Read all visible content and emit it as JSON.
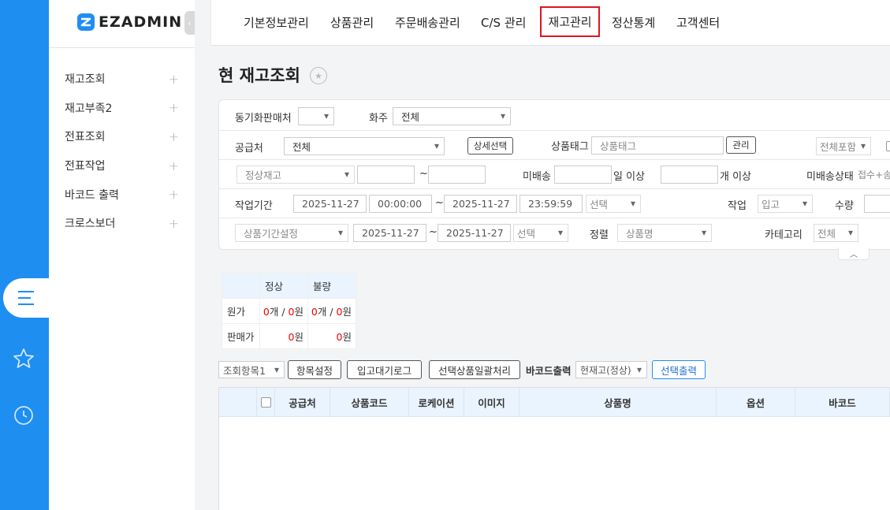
{
  "brand": {
    "logo_text": "EZADMIN",
    "accent": "#1f8ef1"
  },
  "sidebar": {
    "items": [
      {
        "label": "재고조회"
      },
      {
        "label": "재고부족2"
      },
      {
        "label": "전표조회"
      },
      {
        "label": "전표작업"
      },
      {
        "label": "바코드 출력"
      },
      {
        "label": "크로스보더"
      }
    ]
  },
  "rail": {
    "icons": [
      "menu-icon",
      "star-icon",
      "clock-icon"
    ]
  },
  "topnav": {
    "items": [
      "기본정보관리",
      "상품관리",
      "주문배송관리",
      "C/S 관리",
      "재고관리",
      "정산통계",
      "고객센터"
    ],
    "active": "재고관리"
  },
  "page": {
    "title": "현 재고조회"
  },
  "filter": {
    "sync_seller_label": "동기화판매처",
    "owner_label": "화주",
    "owner_value": "전체",
    "supplier_label": "공급처",
    "supplier_value": "전체",
    "detail_select_btn": "상세선택",
    "product_tag_label": "상품태그",
    "product_tag_placeholder": "상품태그",
    "manage_btn": "관리",
    "include_all": "전체포함",
    "stock_type": "정상재고",
    "tilde": "~",
    "undelivered_label": "미배송",
    "days_over": "일 이상",
    "count_over": "개 이상",
    "undelivered_status_label": "미배송상태",
    "undelivered_status_value": "접수+송",
    "period_label": "작업기간",
    "date_from": "2025-11-27",
    "time_from": "00:00:00",
    "date_to": "2025-11-27",
    "time_to": "23:59:59",
    "select_label": "선택",
    "work_label": "작업",
    "work_value": "입고",
    "qty_label": "수량",
    "product_period": "상품기간설정",
    "p_date_from": "2025-11-27",
    "p_date_to": "2025-11-27",
    "sort_label": "정렬",
    "sort_value": "상품명",
    "category_label": "카테고리",
    "category_value": "전체"
  },
  "summary": {
    "headers": [
      "정상",
      "불량"
    ],
    "rows": [
      {
        "label": "원가",
        "normal_count": "0",
        "normal_unit": "개 / ",
        "normal_amount": "0",
        "normal_won": "원",
        "defect_count": "0",
        "defect_unit": "개 / ",
        "defect_amount": "0",
        "defect_won": "원"
      },
      {
        "label": "판매가",
        "normal_amount": "0",
        "normal_won": "원",
        "defect_amount": "0",
        "defect_won": "원"
      }
    ]
  },
  "toolbar": {
    "query_items": "조회항목1",
    "item_settings": "항목설정",
    "inbound_wait_log": "입고대기로그",
    "batch_process": "선택상품일괄처리",
    "barcode_print_label": "바코드출력",
    "barcode_stock": "현재고(정상)",
    "selected_print": "선택출력"
  },
  "grid": {
    "columns": [
      "공급처",
      "상품코드",
      "로케이션",
      "이미지",
      "상품명",
      "옵션",
      "바코드"
    ]
  }
}
